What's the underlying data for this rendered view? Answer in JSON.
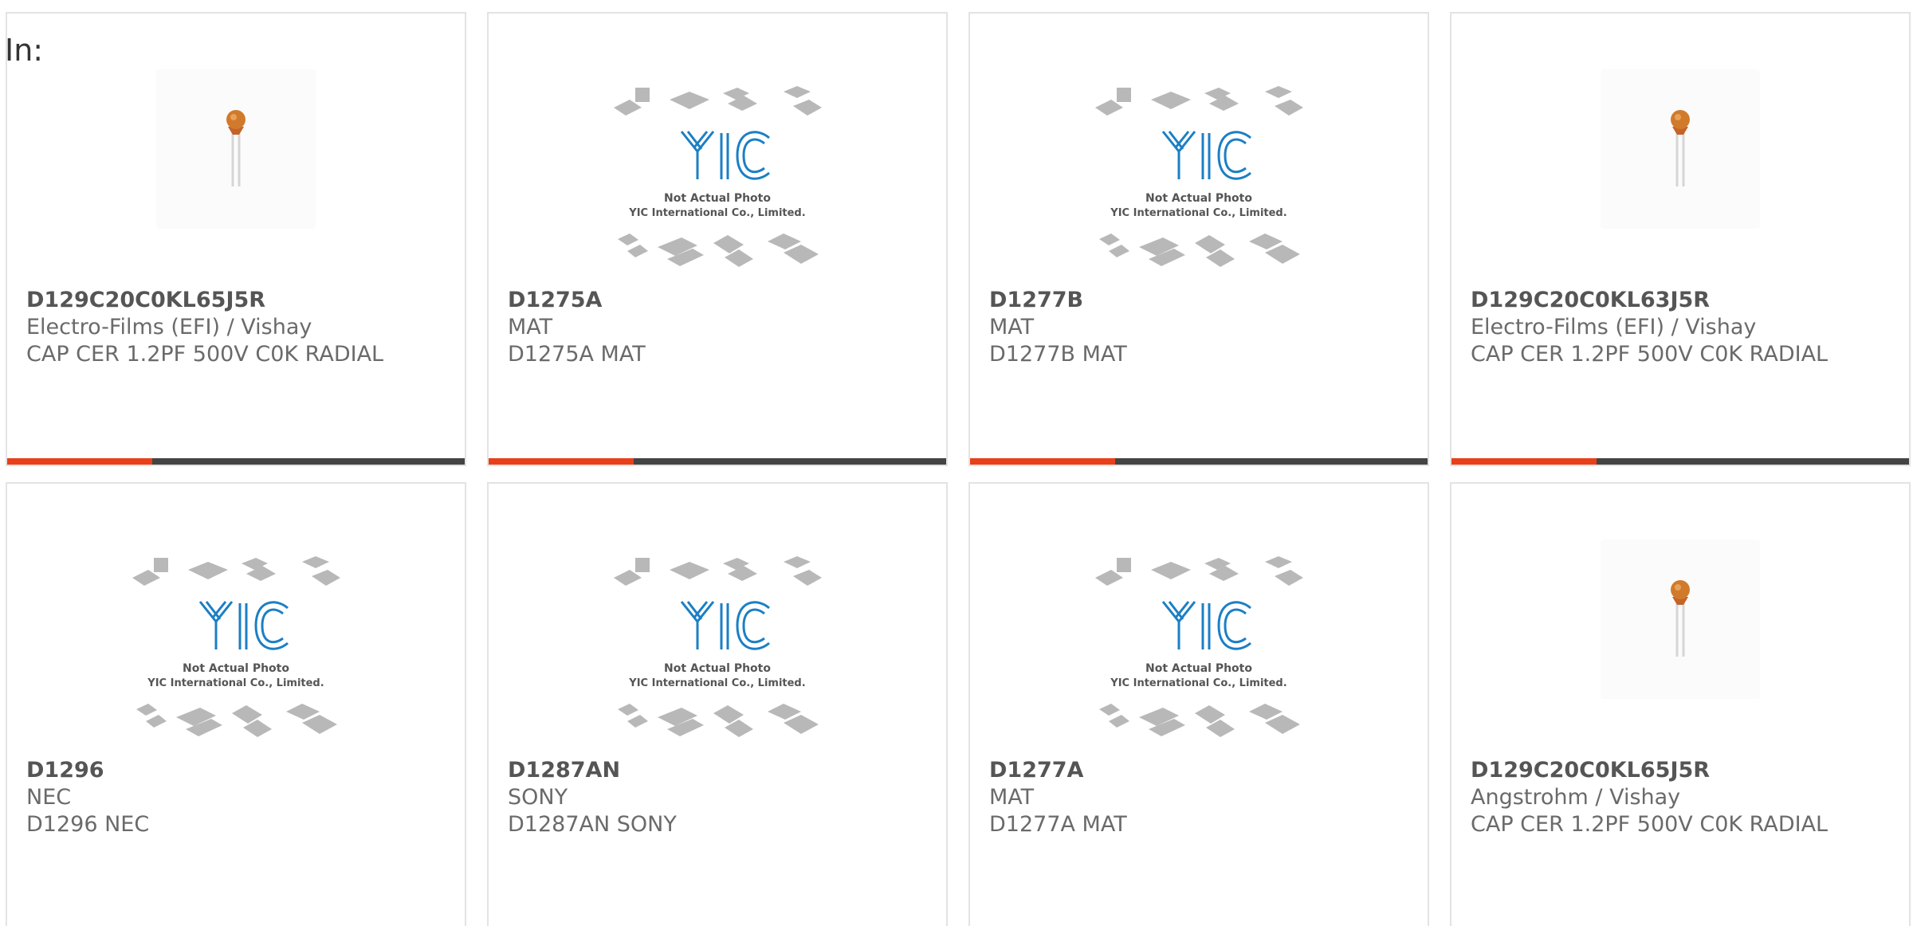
{
  "header": {
    "in_label": "In:"
  },
  "colors": {
    "accent": "#e8401a",
    "bar": "#444444",
    "border": "#e3e3e3",
    "yic_blue": "#1b7fc4"
  },
  "yic_placeholder": {
    "line1": "Not Actual Photo",
    "line2": "YIC International Co., Limited."
  },
  "cards": [
    {
      "image": "capacitor-photo",
      "part": "D129C20C0KL65J5R",
      "manufacturer": "Electro-Films (EFI) / Vishay",
      "description": "CAP CER 1.2PF 500V C0K RADIAL"
    },
    {
      "image": "yic-placeholder",
      "part": "D1275A",
      "manufacturer": "MAT",
      "description": "D1275A MAT"
    },
    {
      "image": "yic-placeholder",
      "part": "D1277B",
      "manufacturer": "MAT",
      "description": "D1277B MAT"
    },
    {
      "image": "capacitor-photo",
      "part": "D129C20C0KL63J5R",
      "manufacturer": "Electro-Films (EFI) / Vishay",
      "description": "CAP CER 1.2PF 500V C0K RADIAL"
    },
    {
      "image": "yic-placeholder",
      "part": "D1296",
      "manufacturer": "NEC",
      "description": "D1296 NEC"
    },
    {
      "image": "yic-placeholder",
      "part": "D1287AN",
      "manufacturer": "SONY",
      "description": "D1287AN SONY"
    },
    {
      "image": "yic-placeholder",
      "part": "D1277A",
      "manufacturer": "MAT",
      "description": "D1277A MAT"
    },
    {
      "image": "capacitor-photo",
      "part": "D129C20C0KL65J5R",
      "manufacturer": "Angstrohm / Vishay",
      "description": "CAP CER 1.2PF 500V C0K RADIAL"
    }
  ]
}
